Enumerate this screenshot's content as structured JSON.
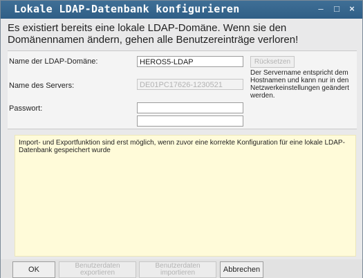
{
  "window": {
    "title": "Lokale LDAP-Datenbank konfigurieren"
  },
  "titlebar": {
    "minimize": "–",
    "maximize": "□",
    "close": "×"
  },
  "warning": "Es existiert bereits eine lokale LDAP-Domäne. Wenn sie den Domänennamen ändern, gehen alle Benutzereinträge verloren!",
  "form": {
    "domain_label": "Name der LDAP-Domäne:",
    "domain_value": "HEROS5-LDAP",
    "reset_label": "Rücksetzen",
    "server_label": "Name des Servers:",
    "server_value": "DE01PC17626-1230521",
    "server_hint": "Der Servername entspricht dem Hostnamen und kann nur in den Netzwerkeinstellungen geändert werden.",
    "password_label": "Passwort:",
    "password_value": "",
    "password_confirm_value": ""
  },
  "info": "Import- und Exportfunktion sind erst möglich, wenn zuvor eine korrekte Konfiguration für eine lokale LDAP-Datenbank gespeichert wurde",
  "footer": {
    "ok": "OK",
    "export_line1": "Benutzerdaten",
    "export_line2": "exportieren",
    "import_line1": "Benutzerdaten",
    "import_line2": "importieren",
    "cancel": "Abbrechen"
  }
}
